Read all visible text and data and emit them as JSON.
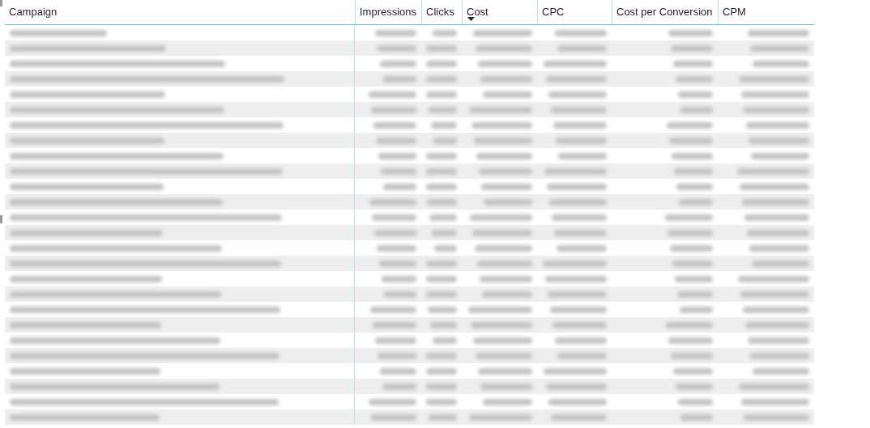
{
  "table": {
    "columns": [
      {
        "label": "Campaign",
        "sorted": false
      },
      {
        "label": "Impressions",
        "sorted": false
      },
      {
        "label": "Clicks",
        "sorted": false
      },
      {
        "label": "Cost",
        "sorted": true
      },
      {
        "label": "CPC",
        "sorted": false
      },
      {
        "label": "Cost per Conversion",
        "sorted": false
      },
      {
        "label": "CPM",
        "sorted": false
      }
    ],
    "rows": [
      {
        "blurred": true
      },
      {
        "blurred": true
      },
      {
        "blurred": true
      },
      {
        "blurred": true
      },
      {
        "blurred": true
      },
      {
        "blurred": true
      },
      {
        "blurred": true
      },
      {
        "blurred": true
      },
      {
        "blurred": true
      },
      {
        "blurred": true
      },
      {
        "blurred": true
      },
      {
        "blurred": true
      },
      {
        "blurred": true
      },
      {
        "blurred": true
      },
      {
        "blurred": true
      },
      {
        "blurred": true
      },
      {
        "blurred": true
      },
      {
        "blurred": true
      },
      {
        "blurred": true
      },
      {
        "blurred": true
      },
      {
        "blurred": true
      },
      {
        "blurred": true
      },
      {
        "blurred": true
      },
      {
        "blurred": true
      },
      {
        "blurred": true
      },
      {
        "blurred": true
      }
    ]
  }
}
